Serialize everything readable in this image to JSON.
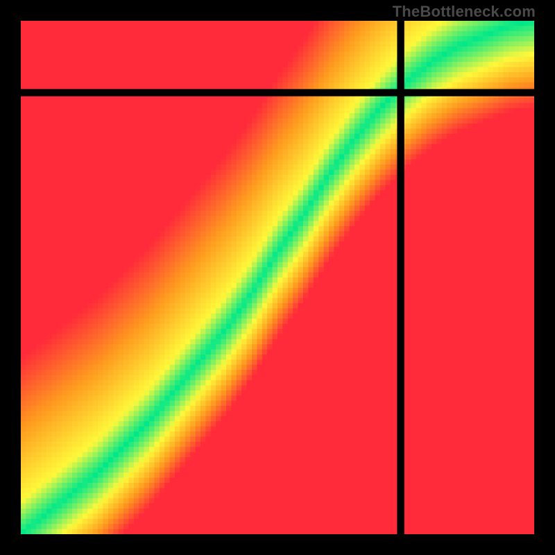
{
  "watermark": "TheBottleneck.com",
  "colors": {
    "background": "#000000",
    "frame": "#000000",
    "gradient": {
      "red": "#ff2a3a",
      "orange": "#ff9a1f",
      "yellow": "#fff83a",
      "green": "#00e88a"
    },
    "watermark_text": "#4a4a4a"
  },
  "chart_data": {
    "type": "heatmap",
    "title": "",
    "xlabel": "",
    "ylabel": "",
    "xlim": [
      0,
      100
    ],
    "ylim": [
      0,
      100
    ],
    "crosshair": {
      "x": 74,
      "y": 86
    },
    "marker": {
      "x": 74,
      "y": 86
    },
    "optimal_curve_x": [
      0,
      5,
      10,
      15,
      20,
      25,
      30,
      35,
      40,
      45,
      50,
      55,
      60,
      65,
      70,
      75,
      80,
      85,
      90,
      95,
      100
    ],
    "optimal_curve_y": [
      0,
      4,
      8,
      12,
      17,
      22,
      28,
      34,
      40,
      47,
      55,
      62,
      70,
      77,
      83,
      88,
      92,
      95,
      97,
      99,
      100
    ],
    "optimal_band_halfwidth": 4,
    "note": "Heatmap color encodes |y - f(x)| distance from optimal curve; green=0, yellow≈band edge, orange/red=far."
  }
}
